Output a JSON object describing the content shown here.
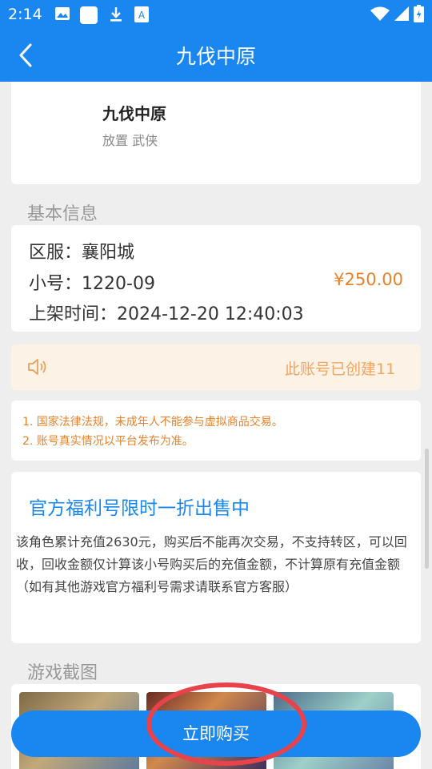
{
  "status_bar": {
    "time": "2:14",
    "icons": [
      "image-icon",
      "app-square-icon",
      "download-icon",
      "a-badge-icon",
      "wifi-icon",
      "signal-icon",
      "battery-icon"
    ]
  },
  "app_bar": {
    "title": "九伐中原",
    "back_icon": "chevron-left-icon"
  },
  "game": {
    "name": "九伐中原",
    "tags": "放置 武侠"
  },
  "basic_info": {
    "section_title": "基本信息",
    "server_label": "区服：",
    "server_value": "襄阳城",
    "account_label": "小号：",
    "account_value": "1220-09",
    "price": "¥250.00",
    "listed_label": "上架时间：",
    "listed_value": "2024-12-20 12:40:03"
  },
  "notice": {
    "icon": "speaker-icon",
    "text": "此账号已创建11"
  },
  "rules": [
    "1. 国家法律法规，未成年人不能参与虚拟商品交易。",
    "2. 账号真实情况以平台发布为准。"
  ],
  "description": {
    "title": "官方福利号限时一折出售中",
    "text": "该角色累计充值2630元，购买后不能再次交易，不支持转区，可以回收，回收金额仅计算该小号购买后的充值金额，不计算原有充值金额（如有其他游戏官方福利号需求请联系官方客服）"
  },
  "screenshots": {
    "section_title": "游戏截图"
  },
  "buy_button": {
    "label": "立即购买"
  },
  "colors": {
    "primary": "#1a87f0",
    "price": "#e8822a",
    "highlight_circle": "#e8434b"
  }
}
